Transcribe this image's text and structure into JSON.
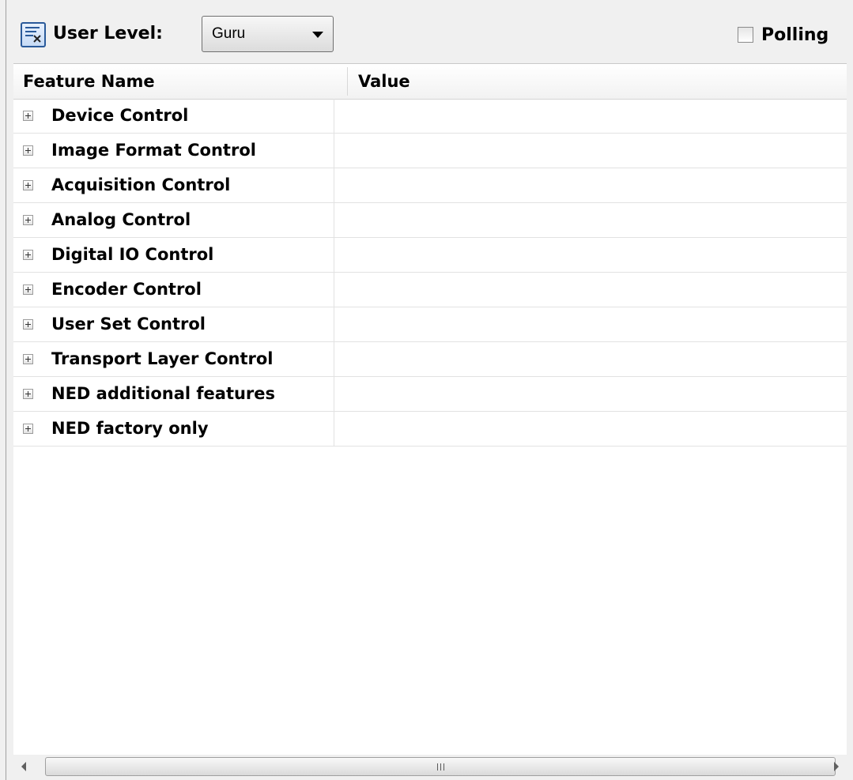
{
  "toolbar": {
    "tool_icon": "properties-icon",
    "user_level_label": "User Level:",
    "user_level_value": "Guru",
    "polling_label": "Polling"
  },
  "grid": {
    "columns": [
      "Feature Name",
      "Value"
    ],
    "rows": [
      {
        "name": "Device Control",
        "value": ""
      },
      {
        "name": "Image Format Control",
        "value": ""
      },
      {
        "name": "Acquisition Control",
        "value": ""
      },
      {
        "name": "Analog Control",
        "value": ""
      },
      {
        "name": "Digital IO Control",
        "value": ""
      },
      {
        "name": "Encoder Control",
        "value": ""
      },
      {
        "name": "User Set Control",
        "value": ""
      },
      {
        "name": "Transport Layer Control",
        "value": ""
      },
      {
        "name": "NED additional features",
        "value": ""
      },
      {
        "name": "NED factory only",
        "value": ""
      }
    ]
  },
  "scrollbar": {
    "left_icon": "scroll-left-icon",
    "right_icon": "scroll-right-icon",
    "grip_icon": "grip-icon"
  }
}
